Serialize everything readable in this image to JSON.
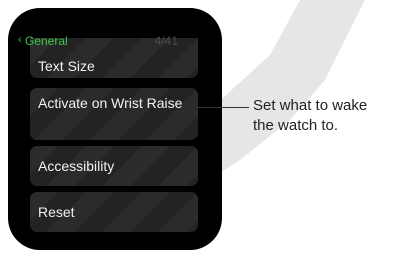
{
  "header": {
    "back_label": "General",
    "page_count": "4/41"
  },
  "icons": {
    "back": "chevron-left-icon"
  },
  "colors": {
    "accent_green": "#3ec24a",
    "cell_background": "#232323",
    "watch_body": "#000000",
    "swoosh": "#e6e6e6"
  },
  "menu": {
    "items": [
      {
        "label": "Text Size"
      },
      {
        "label": "Activate on Wrist Raise"
      },
      {
        "label": "Accessibility"
      },
      {
        "label": "Reset"
      }
    ]
  },
  "callout": {
    "line1": "Set what to wake",
    "line2": "the watch to."
  }
}
